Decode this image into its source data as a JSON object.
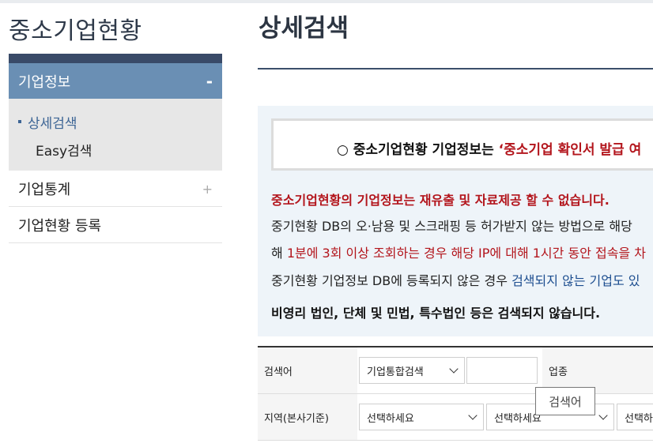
{
  "sidebar": {
    "title": "중소기업현황",
    "active_menu": {
      "label": "기업정보",
      "toggle": "-"
    },
    "submenu": [
      {
        "label": "상세검색"
      },
      {
        "label": "Easy검색"
      }
    ],
    "menus": [
      {
        "label": "기업통계",
        "toggle": "+"
      },
      {
        "label": "기업현황 등록"
      }
    ]
  },
  "main": {
    "title": "상세검색",
    "notice": {
      "box_prefix": "○ 중소기업현황 기업정보는 ",
      "box_red": "‘중소기업 확인서 발급 여",
      "line1": "중소기업현황의 기업정보는 재유출 및 자료제공 할 수 없습니다.",
      "line2": "중기현황 DB의 오·남용 및 스크래핑 등 허가받지 않는 방법으로 해당",
      "line3_a": "해 ",
      "line3_red": "1분에 3회 이상 조회하는 경우 해당 IP에 대해 1시간 동안 접속을 차",
      "line4_a": "중기현황 기업정보 DB에 등록되지 않은 경우 ",
      "line4_blue": "검색되지 않는 기업도 있",
      "line5": "비영리 법인, 단체 및 민법, 특수법인 등은 검색되지 않습니다."
    },
    "search": {
      "row1": {
        "label": "검색어",
        "select_value": "기업통합검색",
        "input_value": "",
        "label2": "업종"
      },
      "row2": {
        "label": "지역(본사기준)",
        "select1": "선택하세요",
        "select2": "선택하세요",
        "select3": "선택하세요"
      }
    },
    "tooltip": "검색어"
  }
}
